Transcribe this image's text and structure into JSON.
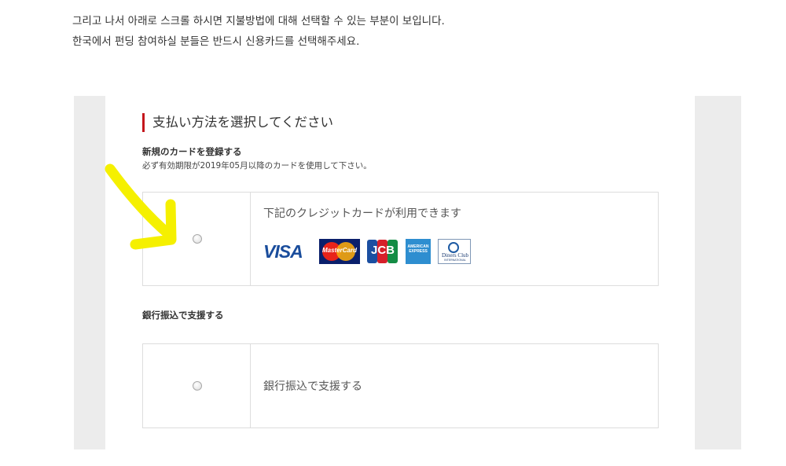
{
  "intro": {
    "line1": "그리고 나서 아래로 스크롤 하시면 지불방법에 대해 선택할 수 있는 부분이 보입니다.",
    "line2": "한국에서 펀딩 참여하실 분들은 반드시 신용카드를 선택해주세요."
  },
  "payment": {
    "title": "支払い方法を選択してください",
    "new_card_heading": "新規のカードを登録する",
    "expiry_note": "必ず有効期限が2019年05月以降のカードを使用して下さい。",
    "card_option_label": "下記のクレジットカードが利用できます",
    "card_brands": {
      "visa": "VISA",
      "mastercard": "MasterCard",
      "jcb": "JCB",
      "amex": "AMERICAN EXPRESS",
      "diners_name": "Diners Club",
      "diners_sub": "INTERNATIONAL"
    },
    "bank_heading": "銀行振込で支援する",
    "bank_option_label": "銀行振込で支援する"
  },
  "colors": {
    "accent": "#c4161c",
    "annotation_arrow": "#f5f000"
  },
  "annotation": {
    "icon": "yellow-arrow-icon"
  }
}
